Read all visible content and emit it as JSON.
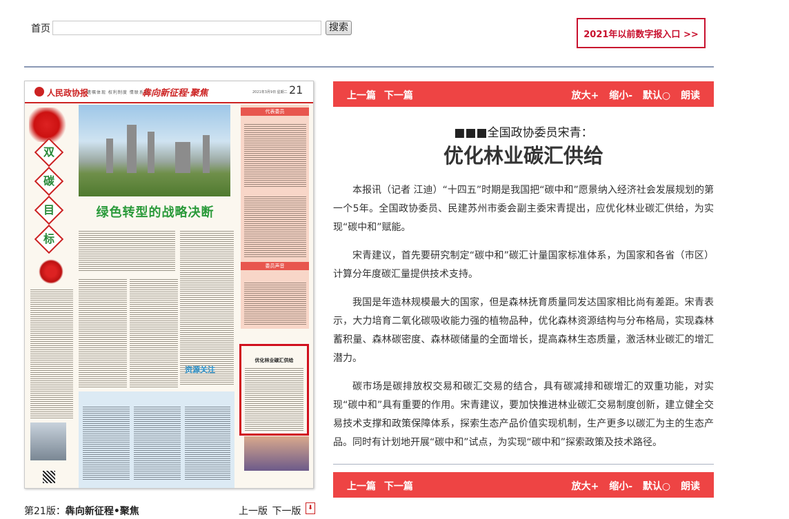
{
  "header": {
    "home_label": "首页",
    "search_button_label": "搜索",
    "old_entry_label": "2021年以前数字报入口 >>"
  },
  "newspaper_page": {
    "masthead": "人民政协报",
    "nav_items": "遗嘱体现 权利制度 情联系在",
    "section_name": "犇向新征程·聚焦",
    "date": "2021年3月9日 星期二",
    "page_number": "21",
    "side_chars": [
      "双",
      "碳",
      "目",
      "标"
    ],
    "main_headline": "绿色转型的战略决断",
    "right_col_label": "代表委员",
    "right_col_label_2": "委员声音",
    "highlight_title": "优化林业碳汇供给",
    "logo_text": "资源关注"
  },
  "footer": {
    "page_prefix": "第21版：",
    "page_section": "犇向新征程•聚焦",
    "prev_page": "上一版",
    "next_page": "下一版",
    "pdf_icon_label": "PDF"
  },
  "toolbar": {
    "prev_article": "上一篇",
    "next_article": "下一篇",
    "zoom_in": "放大+",
    "zoom_out": "缩小-",
    "default_size": "默认○",
    "read_aloud": "朗读"
  },
  "article": {
    "kicker": "■■■全国政协委员宋青：",
    "title": "优化林业碳汇供给",
    "paragraphs": [
      "本报讯（记者 江迪）“十四五”时期是我国把“碳中和”愿景纳入经济社会发展规划的第一个5年。全国政协委员、民建苏州市委会副主委宋青提出，应优化林业碳汇供给，为实现“碳中和”赋能。",
      "宋青建议，首先要研究制定“碳中和”碳汇计量国家标准体系，为国家和各省（市区）计算分年度碳汇量提供技术支持。",
      "我国是年造林规模最大的国家，但是森林抚育质量同发达国家相比尚有差距。宋青表示，大力培育二氧化碳吸收能力强的植物品种，优化森林资源结构与分布格局，实现森林蓄积量、森林碳密度、森林碳储量的全面增长，提高森林生态质量，激活林业碳汇的增汇潜力。",
      "碳市场是碳排放权交易和碳汇交易的结合，具有碳减排和碳增汇的双重功能，对实现“碳中和”具有重要的作用。宋青建议，要加快推进林业碳汇交易制度创新，建立健全交易技术支撑和政策保障体系，探索生态产品价值实现机制，生产更多以碳汇为主的生态产品。同时有计划地开展“碳中和”试点，为实现“碳中和”探索政策及技术路径。"
    ]
  }
}
